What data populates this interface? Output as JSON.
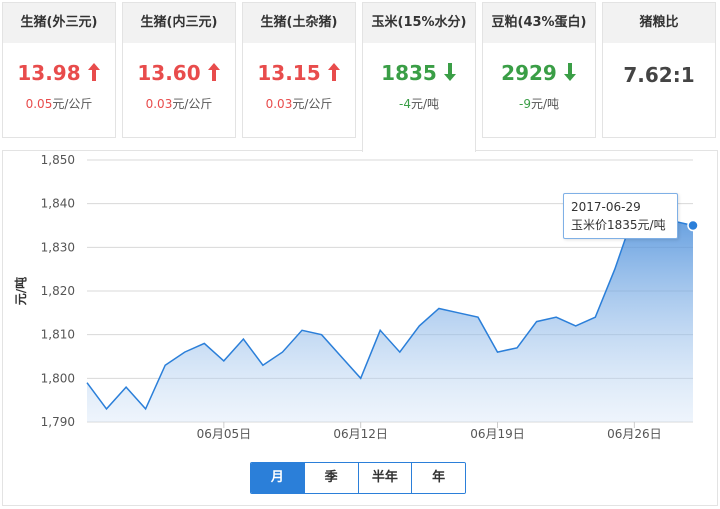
{
  "cards": [
    {
      "title": "生猪(外三元)",
      "value": "13.98",
      "trend": "up",
      "delta": "0.05",
      "unit": "元/公斤"
    },
    {
      "title": "生猪(内三元)",
      "value": "13.60",
      "trend": "up",
      "delta": "0.03",
      "unit": "元/公斤"
    },
    {
      "title": "生猪(土杂猪)",
      "value": "13.15",
      "trend": "up",
      "delta": "0.03",
      "unit": "元/公斤"
    },
    {
      "title": "玉米(15%水分)",
      "value": "1835",
      "trend": "down",
      "delta": "-4",
      "unit": "元/吨"
    },
    {
      "title": "豆粕(43%蛋白)",
      "value": "2929",
      "trend": "down",
      "delta": "-9",
      "unit": "元/吨"
    },
    {
      "title": "猪粮比",
      "value": "7.62:1",
      "trend": "none",
      "delta": "",
      "unit": ""
    }
  ],
  "colors": {
    "up": "#e84c4c",
    "down": "#3a9e46",
    "accent": "#2b7fd9",
    "area": "#5b9be0"
  },
  "icons": {
    "up": "arrow-up-icon",
    "down": "arrow-down-icon"
  },
  "range_buttons": [
    {
      "label": "月",
      "selected": true
    },
    {
      "label": "季",
      "selected": false
    },
    {
      "label": "半年",
      "selected": false
    },
    {
      "label": "年",
      "selected": false
    }
  ],
  "tooltip": {
    "date": "2017-06-29",
    "text": "玉米价1835元/吨"
  },
  "chart_data": {
    "type": "area",
    "ylabel": "元/吨",
    "ylim": [
      1790,
      1850
    ],
    "yticks": [
      "1,790",
      "1,800",
      "1,810",
      "1,820",
      "1,830",
      "1,840",
      "1,850"
    ],
    "xticks": [
      "06月05日",
      "06月12日",
      "06月19日",
      "06月26日"
    ],
    "grid": true,
    "series": [
      {
        "x": [
          "2017-05-29",
          "2017-05-30",
          "2017-05-31",
          "2017-06-01",
          "2017-06-02",
          "2017-06-03",
          "2017-06-04",
          "2017-06-05",
          "2017-06-06",
          "2017-06-07",
          "2017-06-08",
          "2017-06-09",
          "2017-06-10",
          "2017-06-11",
          "2017-06-12",
          "2017-06-13",
          "2017-06-14",
          "2017-06-15",
          "2017-06-16",
          "2017-06-17",
          "2017-06-18",
          "2017-06-19",
          "2017-06-20",
          "2017-06-21",
          "2017-06-22",
          "2017-06-23",
          "2017-06-24",
          "2017-06-25",
          "2017-06-26",
          "2017-06-27",
          "2017-06-28",
          "2017-06-29"
        ],
        "values": [
          1799,
          1793,
          1798,
          1793,
          1803,
          1806,
          1808,
          1804,
          1809,
          1803,
          1806,
          1811,
          1810,
          1805,
          1800,
          1811,
          1806,
          1812,
          1816,
          1815,
          1814,
          1806,
          1807,
          1813,
          1814,
          1812,
          1814,
          1825,
          1838,
          1839,
          1836,
          1835
        ]
      }
    ]
  }
}
